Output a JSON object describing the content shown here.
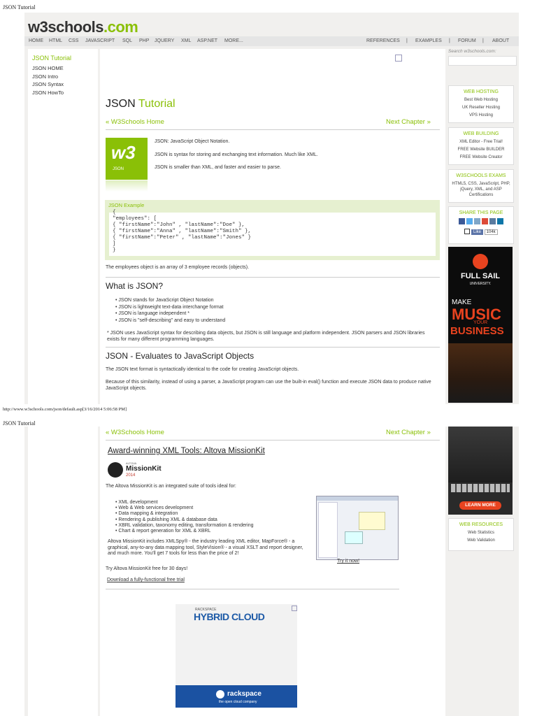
{
  "page_header": "JSON Tutorial",
  "page2_header": "JSON Tutorial",
  "footer_url": "http://www.w3schools.com/json/default.asp[3/16/2014 5:06:58 PM]",
  "logo": {
    "main": "w3schools",
    "tld": ".com"
  },
  "nav_left": [
    "HOME",
    "HTML",
    "CSS",
    "JAVASCRIPT",
    "SQL",
    "PHP",
    "JQUERY",
    "XML",
    "ASP.NET",
    "MORE..."
  ],
  "nav_right": [
    "REFERENCES",
    "|",
    "EXAMPLES",
    "|",
    "FORUM",
    "|",
    "ABOUT"
  ],
  "search_label": "Search w3schools.com:",
  "sidebar": {
    "title": "JSON Tutorial",
    "items": [
      "JSON HOME",
      "JSON Intro",
      "JSON Syntax",
      "JSON HowTo"
    ]
  },
  "main": {
    "title_a": "JSON",
    "title_b": "Tutorial",
    "prev": "« W3Schools Home",
    "next": "Next Chapter »",
    "w3_badge": "JSON",
    "intro": [
      "JSON: JavaScript Object Notation.",
      "JSON is syntax for storing and exchanging text information. Much like XML.",
      "JSON is smaller than XML, and faster and easier to parse."
    ],
    "example_header": "JSON Example",
    "code_lines": [
      "{",
      "\"employees\": [",
      "{ \"firstName\":\"John\" , \"lastName\":\"Doe\" },",
      "{ \"firstName\":\"Anna\" , \"lastName\":\"Smith\" },",
      "{ \"firstName\":\"Peter\" , \"lastName\":\"Jones\" }",
      "]",
      "}"
    ],
    "example_note": "The employees object is an array of 3 employee records (objects).",
    "what_heading": "What is JSON?",
    "what_items": [
      "JSON stands for JavaScript Object Notation",
      "JSON is lightweight text-data interchange format",
      "JSON is language independent *",
      "JSON is \"self-describing\" and easy to understand"
    ],
    "footnote": "* JSON uses JavaScript syntax for describing data objects, but JSON is still language and platform independent. JSON parsers and JSON libraries exists for many different programming languages.",
    "eval_heading": "JSON - Evaluates to JavaScript Objects",
    "eval_p1": "The JSON text format is syntactically identical to the code for creating JavaScript objects.",
    "eval_p2": "Because of this similarity, instead of using a parser, a JavaScript program can use the built-in eval() function and execute JSON data to produce native JavaScript objects."
  },
  "right": {
    "hosting": {
      "title": "WEB HOSTING",
      "items": [
        "Best Web Hosting",
        "UK Reseller Hosting",
        "VPS Hosting"
      ]
    },
    "building": {
      "title": "WEB BUILDING",
      "items": [
        "XML Editor - Free Trial!",
        "FREE Website BUILDER",
        "FREE Website Creator"
      ]
    },
    "exams": {
      "title": "W3SCHOOLS EXAMS",
      "text": "HTML5, CSS, JavaScript, PHP, jQuery, XML, and ASP Certifications"
    },
    "share": {
      "title": "SHARE THIS PAGE",
      "like": "Like",
      "count": "104k"
    },
    "ad": {
      "brand": "FULL SAIL",
      "brand_sub": "UNIVERSITY.",
      "make": "MAKE",
      "music": "MUSIC",
      "your": "YOUR",
      "business": "BUSINESS"
    },
    "resources": {
      "title": "WEB RESOURCES",
      "items": [
        "Web Statistics",
        "Web Validation"
      ]
    },
    "learn_more": "LEARN MORE"
  },
  "page2": {
    "prev": "« W3Schools Home",
    "next": "Next Chapter »",
    "ad_heading": "Award-winning XML Tools: Altova MissionKit",
    "mk_top": "ALTOVA",
    "mk_name": "MissionKit",
    "mk_year": "2014",
    "intro": "The Altova MissionKit is an integrated suite of tools ideal for:",
    "list": [
      "XML development",
      "Web & Web services development",
      "Data mapping & integration",
      "Rendering & publishing XML & database data",
      "XBRL validation, taxonomy editing, transformation & rendering",
      "Chart & report generation for XML & XBRL"
    ],
    "desc": "Altova MissionKit includes XMLSpy® - the industry leading XML editor, MapForce® - a graphical, any-to-any data mapping tool, StyleVision® - a visual XSLT and report designer, and much more. You'll get 7 tools for less than the price of 2!",
    "try_text": "Try Altova MissionKit free for 30 days!",
    "download": "Download a fully-functional free trial",
    "try_now": "Try it now!",
    "rack_small": "RACKSPACE",
    "rack_big": "HYBRID CLOUD",
    "rack_logo": "rackspace",
    "rack_tag": "the open cloud company"
  }
}
